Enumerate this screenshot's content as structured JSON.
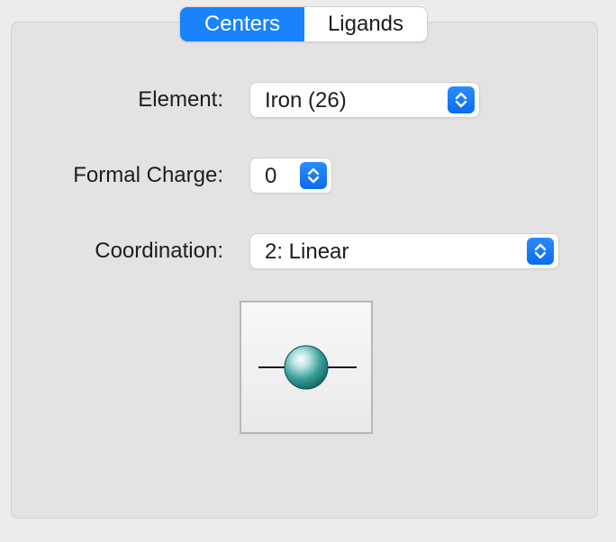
{
  "tabs": {
    "centers": "Centers",
    "ligands": "Ligands"
  },
  "element": {
    "label": "Element:",
    "value": "Iron (26)"
  },
  "formal_charge": {
    "label": "Formal Charge:",
    "value": "0"
  },
  "coordination": {
    "label": "Coordination:",
    "value": "2: Linear"
  },
  "preview": {
    "geometry": "linear",
    "atom_color": "#2a8f8c"
  },
  "colors": {
    "accent": "#1a82fb",
    "panel": "#e3e3e3"
  }
}
